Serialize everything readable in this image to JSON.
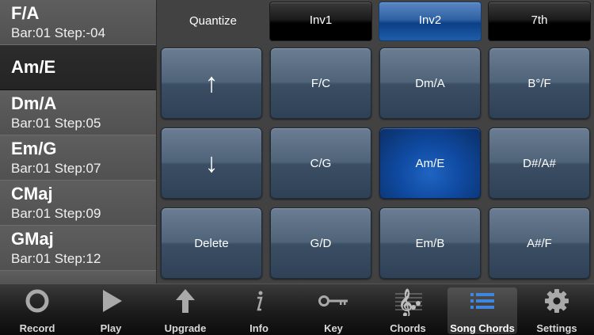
{
  "chord_list": [
    {
      "name": "F/A",
      "position": "Bar:01 Step:-04",
      "selected": false
    },
    {
      "name": "Am/E",
      "position": "",
      "selected": true
    },
    {
      "name": "Dm/A",
      "position": "Bar:01 Step:05",
      "selected": false
    },
    {
      "name": "Em/G",
      "position": "Bar:01 Step:07",
      "selected": false
    },
    {
      "name": "CMaj",
      "position": "Bar:01 Step:09",
      "selected": false
    },
    {
      "name": "GMaj",
      "position": "Bar:01 Step:12",
      "selected": false
    }
  ],
  "pad": {
    "quantize_label": "Quantize",
    "inversions": [
      {
        "label": "Inv1",
        "active": false
      },
      {
        "label": "Inv2",
        "active": true
      },
      {
        "label": "7th",
        "active": false
      }
    ],
    "up_arrow": "↑",
    "down_arrow": "↓",
    "delete_label": "Delete",
    "chords": [
      [
        "F/C",
        "Dm/A",
        "B°/F"
      ],
      [
        "C/G",
        "Am/E",
        "D#/A#"
      ],
      [
        "G/D",
        "Em/B",
        "A#/F"
      ]
    ],
    "active_chord": "Am/E",
    "accent_color": "#1f64c2"
  },
  "tabbar": {
    "tabs": [
      {
        "label": "Record",
        "icon": "record-icon",
        "active": false
      },
      {
        "label": "Play",
        "icon": "play-icon",
        "active": false
      },
      {
        "label": "Upgrade",
        "icon": "upgrade-arrow-icon",
        "active": false
      },
      {
        "label": "Info",
        "icon": "info-icon",
        "active": false
      },
      {
        "label": "Key",
        "icon": "key-icon",
        "active": false
      },
      {
        "label": "Chords",
        "icon": "treble-clef-icon",
        "active": false
      },
      {
        "label": "Song Chords",
        "icon": "list-icon",
        "active": true
      },
      {
        "label": "Settings",
        "icon": "gear-icon",
        "active": false
      }
    ]
  }
}
